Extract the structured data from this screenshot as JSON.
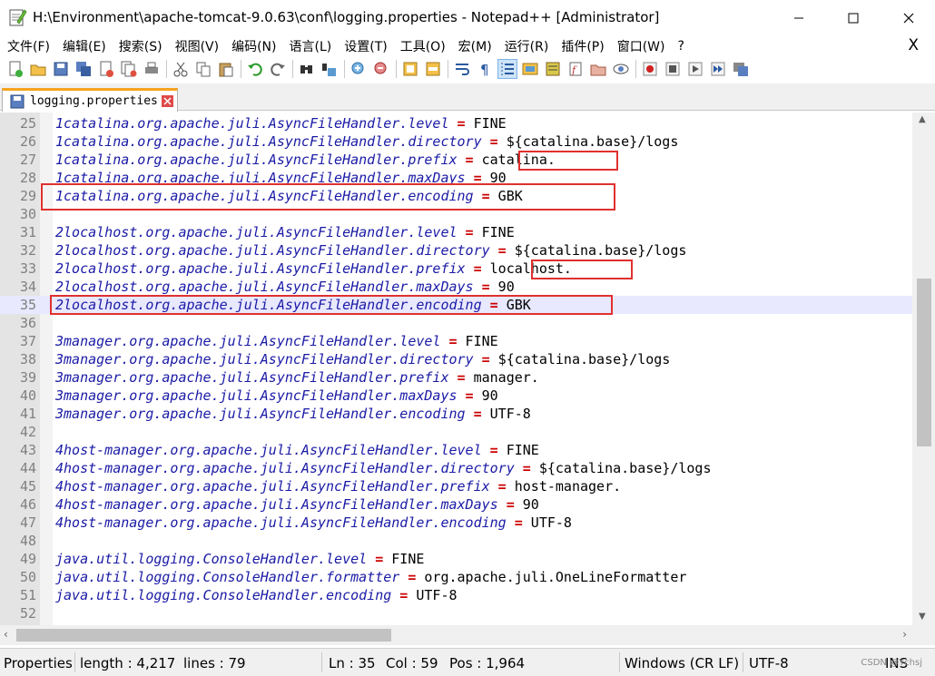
{
  "window": {
    "title": "H:\\Environment\\apache-tomcat-9.0.63\\conf\\logging.properties - Notepad++ [Administrator]",
    "close_glyph": "✕",
    "max_glyph": "☐",
    "min_glyph": "—"
  },
  "menu": {
    "items": [
      "文件(F)",
      "编辑(E)",
      "搜索(S)",
      "视图(V)",
      "编码(N)",
      "语言(L)",
      "设置(T)",
      "工具(O)",
      "宏(M)",
      "运行(R)",
      "插件(P)",
      "窗口(W)",
      "?"
    ],
    "close_label": "X"
  },
  "tab": {
    "label": "logging.properties"
  },
  "editor": {
    "current_line": 35,
    "lines": [
      {
        "num": "25",
        "key": "1catalina.org.apache.juli.AsyncFileHandler.level",
        "value": "FINE"
      },
      {
        "num": "26",
        "key": "1catalina.org.apache.juli.AsyncFileHandler.directory",
        "value": "${catalina.base}/logs"
      },
      {
        "num": "27",
        "key": "1catalina.org.apache.juli.AsyncFileHandler.prefix",
        "value": "catalina."
      },
      {
        "num": "28",
        "key": "1catalina.org.apache.juli.AsyncFileHandler.maxDays",
        "value": "90"
      },
      {
        "num": "29",
        "key": "1catalina.org.apache.juli.AsyncFileHandler.encoding",
        "value": "GBK"
      },
      {
        "num": "30",
        "key": "",
        "value": ""
      },
      {
        "num": "31",
        "key": "2localhost.org.apache.juli.AsyncFileHandler.level",
        "value": "FINE"
      },
      {
        "num": "32",
        "key": "2localhost.org.apache.juli.AsyncFileHandler.directory",
        "value": "${catalina.base}/logs"
      },
      {
        "num": "33",
        "key": "2localhost.org.apache.juli.AsyncFileHandler.prefix",
        "value": "localhost."
      },
      {
        "num": "34",
        "key": "2localhost.org.apache.juli.AsyncFileHandler.maxDays",
        "value": "90"
      },
      {
        "num": "35",
        "key": "2localhost.org.apache.juli.AsyncFileHandler.encoding",
        "value": "GBK"
      },
      {
        "num": "36",
        "key": "",
        "value": ""
      },
      {
        "num": "37",
        "key": "3manager.org.apache.juli.AsyncFileHandler.level",
        "value": "FINE"
      },
      {
        "num": "38",
        "key": "3manager.org.apache.juli.AsyncFileHandler.directory",
        "value": "${catalina.base}/logs"
      },
      {
        "num": "39",
        "key": "3manager.org.apache.juli.AsyncFileHandler.prefix",
        "value": "manager."
      },
      {
        "num": "40",
        "key": "3manager.org.apache.juli.AsyncFileHandler.maxDays",
        "value": "90"
      },
      {
        "num": "41",
        "key": "3manager.org.apache.juli.AsyncFileHandler.encoding",
        "value": "UTF-8"
      },
      {
        "num": "42",
        "key": "",
        "value": ""
      },
      {
        "num": "43",
        "key": "4host-manager.org.apache.juli.AsyncFileHandler.level",
        "value": "FINE"
      },
      {
        "num": "44",
        "key": "4host-manager.org.apache.juli.AsyncFileHandler.directory",
        "value": "${catalina.base}/logs"
      },
      {
        "num": "45",
        "key": "4host-manager.org.apache.juli.AsyncFileHandler.prefix",
        "value": "host-manager."
      },
      {
        "num": "46",
        "key": "4host-manager.org.apache.juli.AsyncFileHandler.maxDays",
        "value": "90"
      },
      {
        "num": "47",
        "key": "4host-manager.org.apache.juli.AsyncFileHandler.encoding",
        "value": "UTF-8"
      },
      {
        "num": "48",
        "key": "",
        "value": ""
      },
      {
        "num": "49",
        "key": "java.util.logging.ConsoleHandler.level",
        "value": "FINE"
      },
      {
        "num": "50",
        "key": "java.util.logging.ConsoleHandler.formatter",
        "value": "org.apache.juli.OneLineFormatter"
      },
      {
        "num": "51",
        "key": "java.util.logging.ConsoleHandler.encoding",
        "value": "UTF-8"
      },
      {
        "num": "52",
        "key": "",
        "value": ""
      }
    ]
  },
  "status": {
    "file_type": "Properties",
    "length": "length : 4,217",
    "lines": "lines : 79",
    "ln": "Ln : 35",
    "col": "Col : 59",
    "pos": "Pos : 1,964",
    "eol": "Windows (CR LF)",
    "encoding": "UTF-8",
    "mode": "INS",
    "watermark": "CSDN @Ychsj"
  },
  "colors": {
    "key": "#1a1aa6",
    "operator": "#cc0000",
    "highlight_box": "#e0302f",
    "current_line": "#e8e8ff"
  }
}
